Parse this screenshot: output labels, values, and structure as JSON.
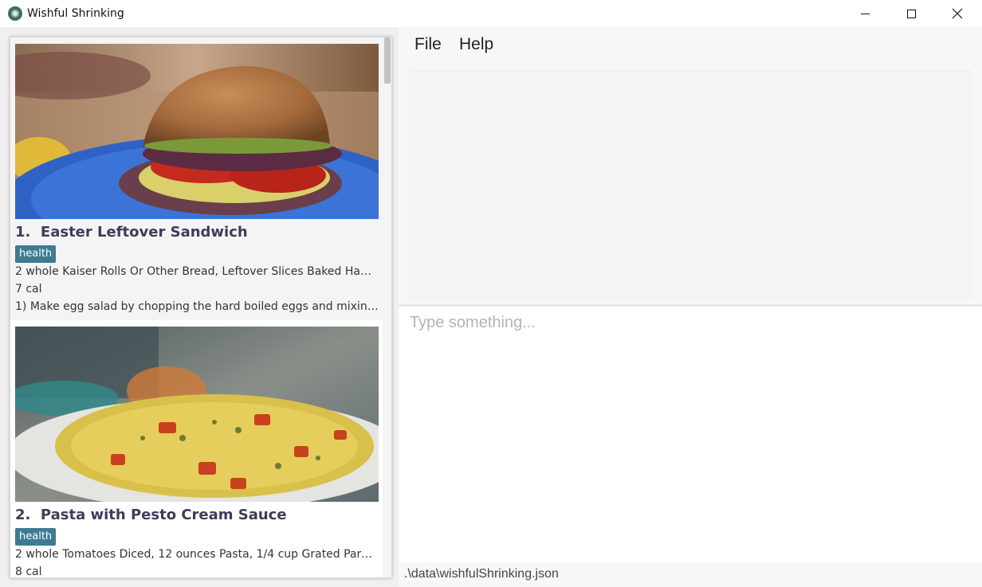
{
  "window": {
    "title": "Wishful Shrinking",
    "icon": "plate-icon"
  },
  "menu": {
    "file": "File",
    "help": "Help"
  },
  "recipes": [
    {
      "index": "1.",
      "name": "Easter Leftover Sandwich",
      "tag": "health",
      "ingredients": "2 whole Kaiser Rolls Or Other Bread, Leftover Slices Baked Ham, ...",
      "calories": "7 cal",
      "instructions": "1) Make egg salad by chopping the hard boiled eggs and mixing them ...",
      "image": "sandwich-photo"
    },
    {
      "index": "2.",
      "name": "Pasta with Pesto Cream Sauce",
      "tag": "health",
      "ingredients": "2 whole Tomatoes Diced, 12 ounces Pasta, 1/4 cup Grated Parmesan ...",
      "calories": "8 cal",
      "image": "pasta-photo"
    }
  ],
  "command": {
    "placeholder": "Type something...",
    "value": ""
  },
  "status": {
    "path": ".\\data\\wishfulShrinking.json"
  }
}
